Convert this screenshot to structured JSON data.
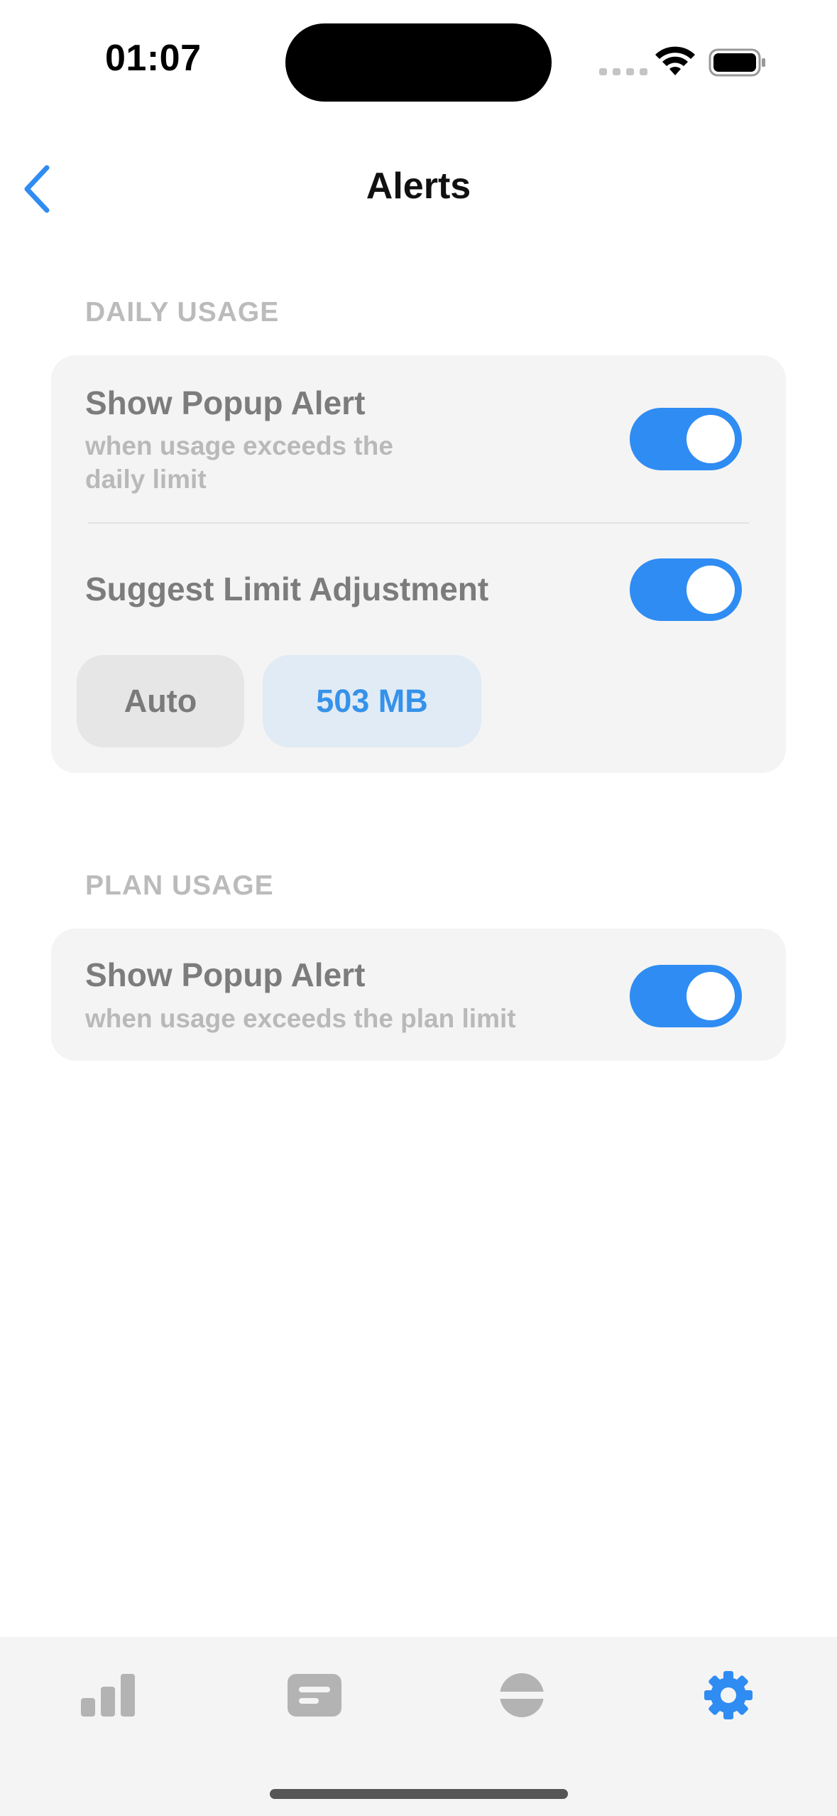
{
  "status_bar": {
    "time": "01:07"
  },
  "nav": {
    "title": "Alerts"
  },
  "daily_usage": {
    "header": "DAILY USAGE",
    "popup_alert": {
      "title": "Show Popup Alert",
      "subtitle_line1": "when usage exceeds the",
      "subtitle_line2": "daily limit",
      "enabled": true
    },
    "suggest_limit": {
      "title": "Suggest Limit Adjustment",
      "enabled": true
    },
    "chips": {
      "auto": "Auto",
      "limit": "503 MB"
    }
  },
  "plan_usage": {
    "header": "PLAN USAGE",
    "popup_alert": {
      "title": "Show Popup Alert",
      "subtitle": "when usage exceeds the plan limit",
      "enabled": true
    }
  },
  "tabbar": {
    "items": [
      {
        "icon": "bar-chart-icon",
        "active": false
      },
      {
        "icon": "message-icon",
        "active": false
      },
      {
        "icon": "plan-icon",
        "active": false
      },
      {
        "icon": "gear-icon",
        "active": true
      }
    ]
  },
  "colors": {
    "accent": "#2f8cf2",
    "inactive_icon": "#b3b3b3",
    "card_bg": "#f4f4f4"
  }
}
